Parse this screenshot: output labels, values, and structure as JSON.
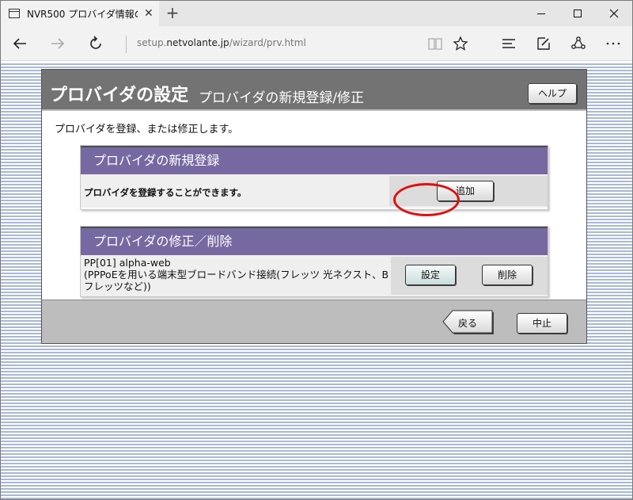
{
  "browser": {
    "tab_title": "NVR500 プロバイダ情報の",
    "tab_close": "✕",
    "new_tab": "+",
    "url_prefix": "setup.",
    "url_host": "netvolante.jp",
    "url_path": "/wizard/prv.html"
  },
  "header": {
    "title": "プロバイダの設定",
    "subtitle": "プロバイダの新規登録/修正",
    "help_label": "ヘルプ"
  },
  "intro": "プロバイダを登録、または修正します。",
  "new_registration": {
    "heading": "プロバイダの新規登録",
    "description": "プロバイダを登録することができます。",
    "add_label": "追加"
  },
  "modify": {
    "heading": "プロバイダの修正／削除",
    "entry_name": "PP[01] alpha-web",
    "entry_detail": "(PPPoEを用いる端末型ブロードバンド接続(フレッツ 光ネクスト、Bフレッツなど))",
    "setting_label": "設定",
    "delete_label": "削除"
  },
  "footer": {
    "back_label": "戻る",
    "cancel_label": "中止"
  },
  "colors": {
    "header_bg": "#737373",
    "section_bg": "#7669a1",
    "highlight_ring": "#e01010",
    "page_stripe": "#a9b8d6"
  }
}
